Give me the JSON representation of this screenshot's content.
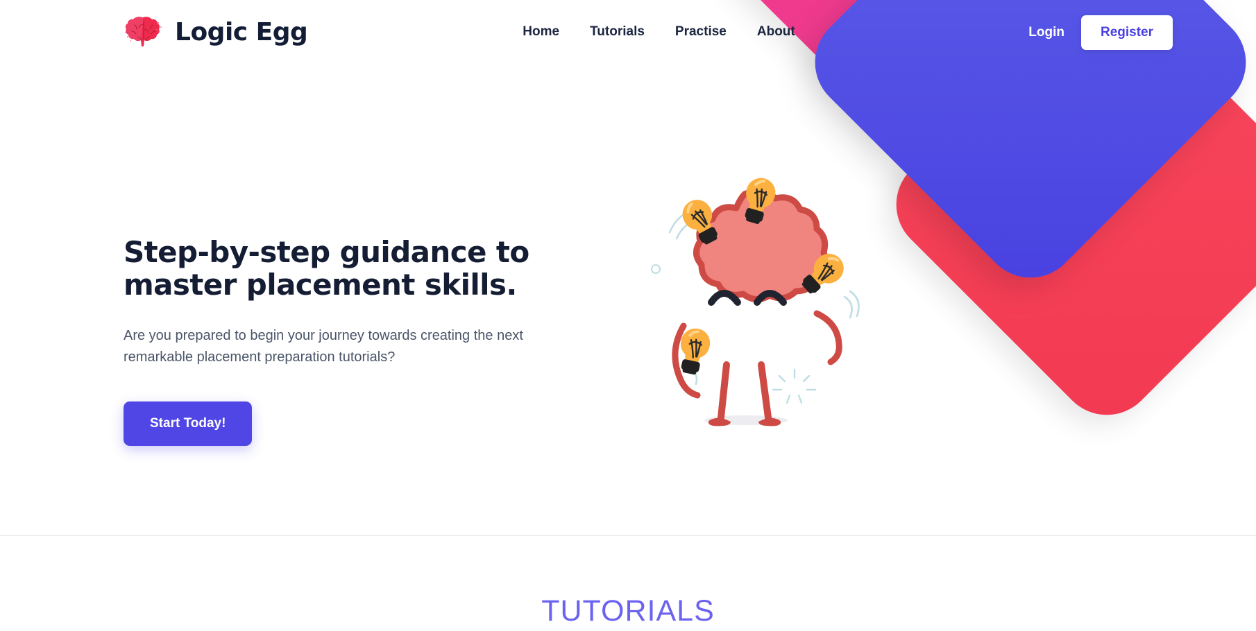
{
  "brand": {
    "name": "Logic Egg",
    "icon": "brain-icon"
  },
  "nav": {
    "items": [
      {
        "label": "Home"
      },
      {
        "label": "Tutorials"
      },
      {
        "label": "Practise"
      },
      {
        "label": "About"
      }
    ]
  },
  "auth": {
    "login_label": "Login",
    "register_label": "Register"
  },
  "hero": {
    "title_line1": "Step-by-step guidance to",
    "title_line2": "master placement skills.",
    "subtitle": "Are you prepared to begin your journey towards creating the next remarkable placement preparation tutorials?",
    "cta_label": "Start Today!",
    "illustration": "brain-juggling-lightbulbs-illustration"
  },
  "tutorials": {
    "heading": "TUTORIALS"
  },
  "colors": {
    "brand_dark": "#141D33",
    "accent_indigo": "#4F46E5",
    "tutorials_indigo": "#6B63F0",
    "shape_pink": "#ED3B8D",
    "shape_blue": "#5059E3",
    "shape_red": "#F4455A",
    "brain_fill": "#F0857F",
    "brain_outline": "#CE4B45",
    "bulb_yellow": "#FBB040",
    "register_text": "#4A3FE0",
    "divider": "#E6E8EC"
  }
}
